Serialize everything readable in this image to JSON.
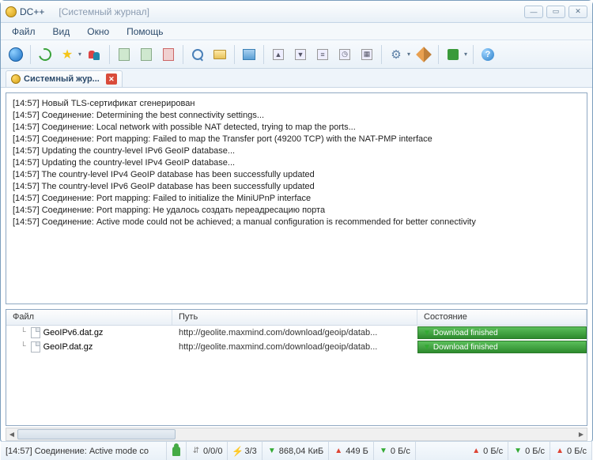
{
  "window": {
    "app": "DC++",
    "subtitle": "[Системный журнал]"
  },
  "menu": {
    "file": "Файл",
    "view": "Вид",
    "window": "Окно",
    "help": "Помощь"
  },
  "tab": {
    "label": "Системный жур..."
  },
  "log": [
    "[14:57] Новый TLS-сертификат сгенерирован",
    "[14:57] Соединение: Determining the best connectivity settings...",
    "[14:57] Соединение: Local network with possible NAT detected, trying to map the ports...",
    "[14:57] Соединение: Port mapping: Failed to map the Transfer port (49200 TCP) with the NAT-PMP interface",
    "[14:57] Updating the country-level IPv6 GeoIP database...",
    "[14:57] Updating the country-level IPv4 GeoIP database...",
    "[14:57] The country-level IPv4 GeoIP database has been successfully updated",
    "[14:57] The country-level IPv6 GeoIP database has been successfully updated",
    "[14:57] Соединение: Port mapping: Failed to initialize the MiniUPnP interface",
    "[14:57] Соединение: Port mapping: Не удалось создать переадресацию порта",
    "[14:57] Соединение: Active mode could not be achieved; a manual configuration is recommended for better connectivity"
  ],
  "downloads": {
    "cols": {
      "file": "Файл",
      "path": "Путь",
      "state": "Состояние"
    },
    "rows": [
      {
        "name": "GeoIPv6.dat.gz",
        "path": "http://geolite.maxmind.com/download/geoip/datab...",
        "state": "Download finished"
      },
      {
        "name": "GeoIP.dat.gz",
        "path": "http://geolite.maxmind.com/download/geoip/datab...",
        "state": "Download finished"
      }
    ]
  },
  "status": {
    "msg": "[14:57] Соединение: Active mode cо",
    "slots": "0/0/0",
    "hubs": "3/3",
    "total": "868,04 КиБ",
    "uploaded": "449 Б",
    "rate0a": "0 Б/с",
    "rate0b": "0 Б/с",
    "rate0c": "0 Б/с",
    "rate0d": "0 Б/с"
  }
}
